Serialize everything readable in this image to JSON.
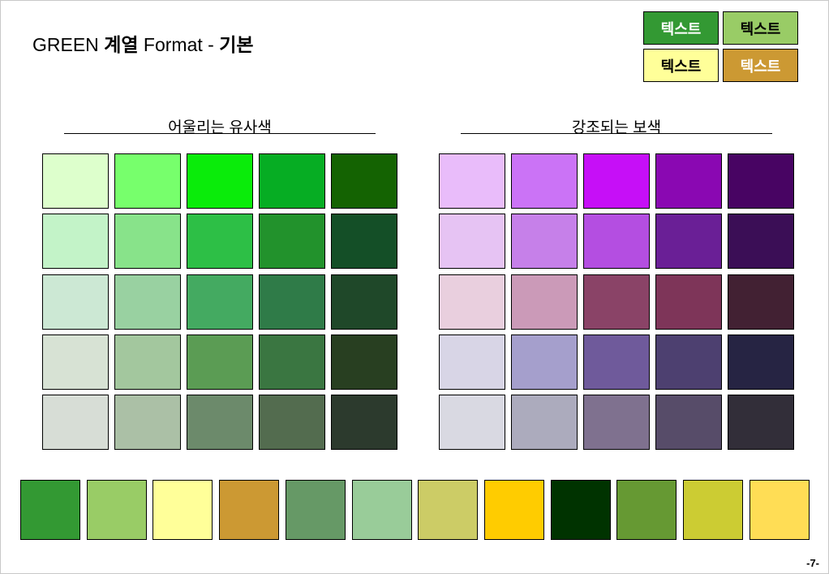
{
  "title": {
    "prefix": "GREEN ",
    "bold1": "계열",
    "middle": " Format - ",
    "bold2": "기본"
  },
  "legend_buttons": [
    {
      "label": "텍스트",
      "bg": "#339933",
      "fg": "#ffffff"
    },
    {
      "label": "텍스트",
      "bg": "#99cc66",
      "fg": "#000000"
    },
    {
      "label": "텍스트",
      "bg": "#ffff99",
      "fg": "#000000"
    },
    {
      "label": "텍스트",
      "bg": "#cc9933",
      "fg": "#ffffff"
    }
  ],
  "left_section": {
    "title": "어울리는 유사색",
    "rows": [
      [
        "#ddffcc",
        "#77ff6c",
        "#0aec0a",
        "#06ad23",
        "#146302"
      ],
      [
        "#c3f3c8",
        "#88e38a",
        "#2dbf46",
        "#22922c",
        "#144f27"
      ],
      [
        "#cce8d4",
        "#99d1a1",
        "#44aa61",
        "#2f7b48",
        "#1f4829"
      ],
      [
        "#d7e2d4",
        "#a3c79e",
        "#5b9c54",
        "#3a7641",
        "#283f21"
      ],
      [
        "#d7ddd6",
        "#abc0a6",
        "#6c8a6b",
        "#536c4f",
        "#2c3a2d"
      ]
    ]
  },
  "right_section": {
    "title": "강조되는 보색",
    "rows": [
      [
        "#e9bcfa",
        "#cb73f6",
        "#c60ff7",
        "#8a08b2",
        "#480463"
      ],
      [
        "#e6c3f3",
        "#c680e9",
        "#b44ee1",
        "#6a1f96",
        "#3b0e56"
      ],
      [
        "#e9cfde",
        "#cb9ab8",
        "#8a4367",
        "#7e3559",
        "#422133"
      ],
      [
        "#d8d5e6",
        "#a59fcc",
        "#6f5a9b",
        "#4d4070",
        "#262443"
      ],
      [
        "#d9d9e2",
        "#acabbd",
        "#7f718f",
        "#574c69",
        "#322e39"
      ]
    ]
  },
  "bottom_palette": [
    "#339933",
    "#99cc66",
    "#ffff99",
    "#cc9933",
    "#669966",
    "#99cc99",
    "#cccc66",
    "#ffcc00",
    "#003300",
    "#669933",
    "#cccc33",
    "#ffdd55"
  ],
  "page_number": "-7-"
}
